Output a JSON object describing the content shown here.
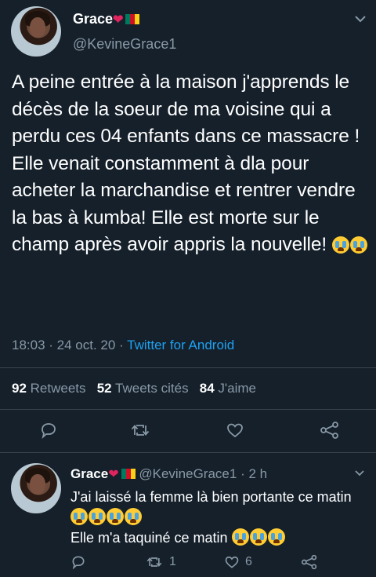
{
  "tweet": {
    "author_name": "Grace",
    "author_handle": "@KevineGrace1",
    "text": "A peine entrée  à la maison j'apprends  le décès de la soeur de ma  voisine qui a perdu ces 04 enfants dans ce massacre ! Elle venait constamment à dla pour acheter la marchandise  et rentrer vendre la bas à kumba! Elle est morte sur le champ après avoir appris la nouvelle!",
    "time": "18:03",
    "date": "24 oct. 20",
    "source": "Twitter for Android",
    "retweets_count": "92",
    "retweets_label": "Retweets",
    "quotes_count": "52",
    "quotes_label": "Tweets cités",
    "likes_count": "84",
    "likes_label": "J'aime"
  },
  "reply": {
    "author_name": "Grace",
    "author_handle": "@KevineGrace1",
    "age": "2 h",
    "line1": "J'ai laissé  la femme là  bien portante ce matin",
    "line2": "Elle m'a taquiné ce matin",
    "retweets": "1",
    "likes": "6"
  },
  "icons": {
    "reply": "reply-icon",
    "retweet": "retweet-icon",
    "like": "heart-icon",
    "share": "share-icon",
    "menu": "chevron-down-icon",
    "emoji": "loudly-crying-face-emoji",
    "flag": "cameroon-flag-emoji",
    "heart_emoji": "red-heart-emoji"
  },
  "colors": {
    "background": "#15202b",
    "secondary_text": "#8899a6",
    "link": "#1da1f2",
    "divider": "#38444d"
  }
}
